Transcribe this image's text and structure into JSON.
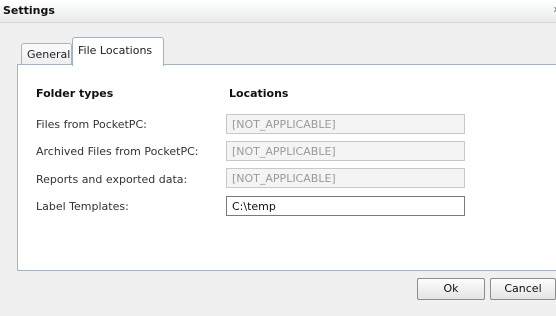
{
  "window": {
    "title": "Settings",
    "close_glyph": "x"
  },
  "tabs": [
    {
      "label": "General"
    },
    {
      "label": "File Locations"
    }
  ],
  "columns": {
    "folder_types": "Folder types",
    "locations": "Locations"
  },
  "rows": [
    {
      "label": "Files from PocketPC:",
      "value": "[NOT_APPLICABLE]"
    },
    {
      "label": "Archived Files from PocketPC:",
      "value": "[NOT_APPLICABLE]"
    },
    {
      "label": "Reports and exported data:",
      "value": "[NOT_APPLICABLE]"
    },
    {
      "label": "Label Templates:",
      "value": "C:\\temp"
    }
  ],
  "buttons": {
    "ok": "Ok",
    "cancel": "Cancel"
  },
  "colors": {
    "tab_border": "#9fb3c8",
    "panel_bg": "#ffffff",
    "window_bg": "#f0f0f0"
  }
}
